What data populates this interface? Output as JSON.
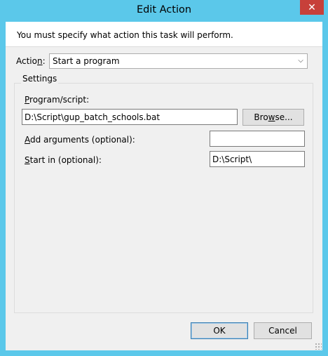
{
  "window": {
    "title": "Edit Action",
    "close_glyph": "✕"
  },
  "instruction": "You must specify what action this task will perform.",
  "action": {
    "label_accel": "n",
    "label_pre": "Actio",
    "label_post": ":",
    "value": "Start a program",
    "arrow_glyph": "⌵"
  },
  "settings": {
    "group_label": "Settings",
    "program": {
      "label_accel": "P",
      "label_rest": "rogram/script:",
      "value": "D:\\Script\\gup_batch_schools.bat"
    },
    "browse": {
      "pre": "Bro",
      "accel": "w",
      "post": "se..."
    },
    "arguments": {
      "label_accel": "A",
      "label_rest": "dd arguments (optional):",
      "value": ""
    },
    "start_in": {
      "label_accel": "S",
      "label_rest": "tart in (optional):",
      "value": "D:\\Script\\"
    }
  },
  "buttons": {
    "ok": "OK",
    "cancel": "Cancel"
  },
  "colors": {
    "frame": "#5bc8ea",
    "close": "#c7403a",
    "client": "#f0f0f0"
  }
}
